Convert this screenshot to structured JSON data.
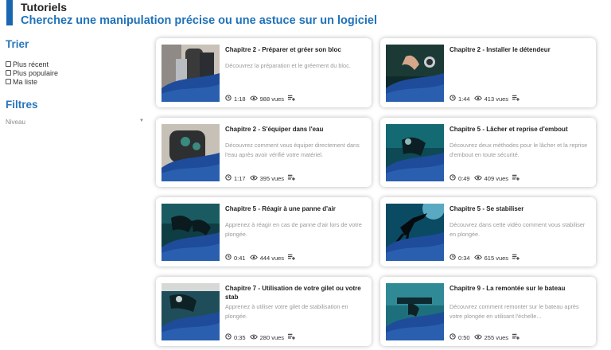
{
  "header": {
    "title": "Tutoriels",
    "subtitle": "Cherchez une manipulation précise ou une astuce sur un logiciel",
    "accent_color": "#1a66b0"
  },
  "sidebar": {
    "sort_title": "Trier",
    "sort_options": [
      "Plus récent",
      "Plus populaire",
      "Ma liste"
    ],
    "filters_title": "Filtres",
    "level_label": "Niveau"
  },
  "cards": [
    {
      "title": "Chapitre 2 - Préparer et gréer son bloc",
      "desc": "Découvrez la préparation et le gréement du bloc.",
      "duration": "1:18",
      "views": "988 vues"
    },
    {
      "title": "Chapitre 2 - Installer le détendeur",
      "desc": "",
      "duration": "1:44",
      "views": "413 vues"
    },
    {
      "title": "Chapitre 2 - S'équiper dans l'eau",
      "desc": "Découvrez comment vous équiper directement dans l'eau après avoir vérifié votre matériel.",
      "duration": "1:17",
      "views": "395 vues"
    },
    {
      "title": "Chapitre 5 - Lâcher et reprise d'embout",
      "desc": "Découvrez deux méthodes pour le lâcher et la reprise d'embout en toute sécurité.",
      "duration": "0:49",
      "views": "409 vues"
    },
    {
      "title": "Chapitre 5 - Réagir à une panne d'air",
      "desc": "Apprenez à réagir en cas de panne d'air lors de votre plongée.",
      "duration": "0:41",
      "views": "444 vues"
    },
    {
      "title": "Chapitre 5 - Se stabiliser",
      "desc": "Découvrez dans cette vidéo comment vous stabiliser en plongée.",
      "duration": "0:34",
      "views": "615 vues"
    },
    {
      "title": "Chapitre 7 - Utilisation de votre gilet ou votre stab",
      "desc": "Apprenez à utiliser votre gilet de stabilisation en plongée.",
      "duration": "0:35",
      "views": "280 vues"
    },
    {
      "title": "Chapitre 9 - La remontée sur le bateau",
      "desc": "Découvrez comment remonter sur le bateau après votre plongée en utilisant l'échelle...",
      "duration": "0:50",
      "views": "255 vues"
    }
  ]
}
